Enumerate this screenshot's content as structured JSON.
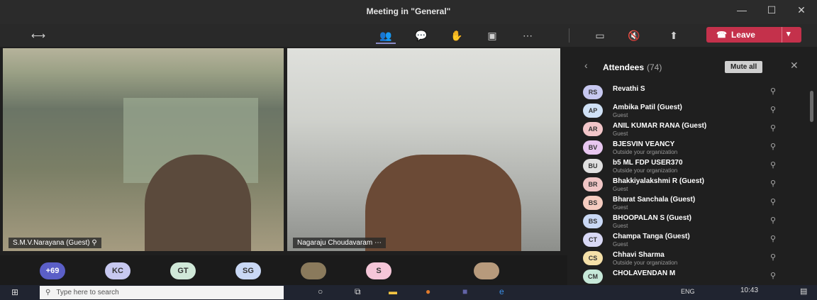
{
  "window": {
    "title": "Meeting in \"General\""
  },
  "toolbar": {
    "leave_label": "Leave"
  },
  "videos": [
    {
      "name": "S.M.V.Narayana (Guest)"
    },
    {
      "name": "Nagaraju Choudavaram"
    }
  ],
  "bottom_participants": [
    "+69",
    "KC",
    "GT",
    "SG",
    "S"
  ],
  "panel": {
    "title": "Attendees",
    "count": "(74)",
    "mute_all": "Mute all"
  },
  "attendees": [
    {
      "initials": "RS",
      "name": "Revathi S",
      "sub": "",
      "color": "#c7c8f0"
    },
    {
      "initials": "AP",
      "name": "Ambika Patil (Guest)",
      "sub": "Guest",
      "color": "#cfe0f5"
    },
    {
      "initials": "AR",
      "name": "ANIL KUMAR RANA (Guest)",
      "sub": "Guest",
      "color": "#f2c6c9"
    },
    {
      "initials": "BV",
      "name": "BJESVIN VEANCY",
      "sub": "Outside your organization",
      "color": "#e8c7f0"
    },
    {
      "initials": "BU",
      "name": "b5 ML FDP USER370",
      "sub": "Outside your organization",
      "color": "#e0e0e0"
    },
    {
      "initials": "BR",
      "name": "Bhakkiyalakshmi R (Guest)",
      "sub": "Guest",
      "color": "#f0c6c6"
    },
    {
      "initials": "BS",
      "name": "Bharat Sanchala (Guest)",
      "sub": "Guest",
      "color": "#f5ccc0"
    },
    {
      "initials": "BS",
      "name": "BHOOPALAN S (Guest)",
      "sub": "Guest",
      "color": "#c9d8f5"
    },
    {
      "initials": "CT",
      "name": "Champa Tanga (Guest)",
      "sub": "Guest",
      "color": "#d8d8f5"
    },
    {
      "initials": "CS",
      "name": "Chhavi Sharma",
      "sub": "Outside your organization",
      "color": "#f5e0a8"
    },
    {
      "initials": "CM",
      "name": "CHOLAVENDAN M",
      "sub": "",
      "color": "#c6e8d8"
    }
  ],
  "taskbar": {
    "search_placeholder": "Type here to search",
    "lang": "ENG",
    "time": "10:43"
  }
}
